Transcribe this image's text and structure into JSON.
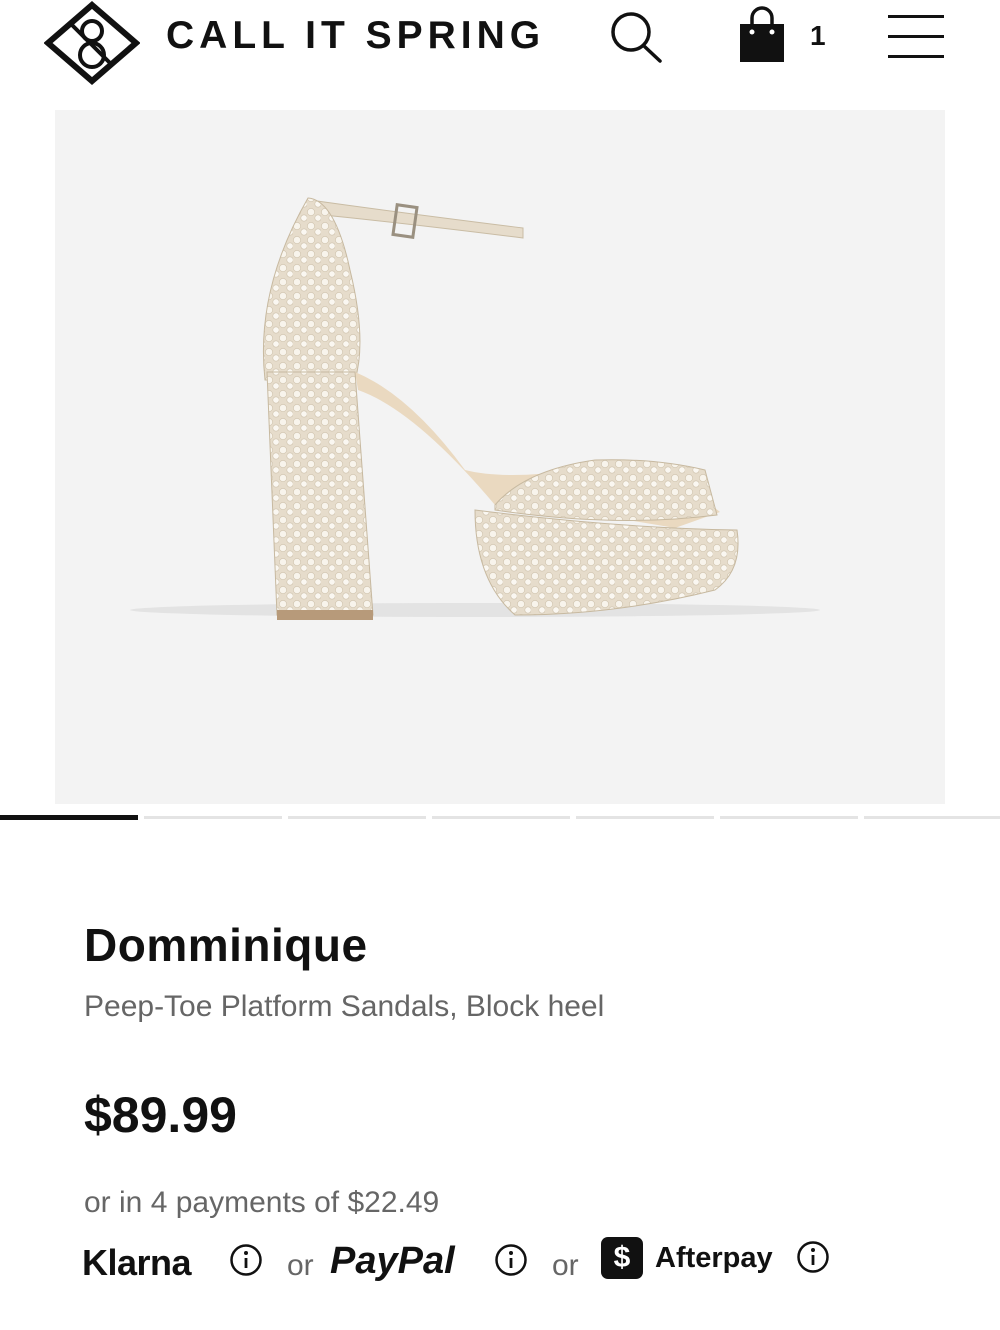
{
  "header": {
    "brand": "CALL IT SPRING",
    "bag_count": "1"
  },
  "icons": {
    "logo": "brand-logo-diamond",
    "search": "search-icon",
    "bag": "shopping-bag-icon",
    "menu": "hamburger-menu-icon",
    "info": "info-icon"
  },
  "carousel": {
    "total": 7,
    "active_index": 0
  },
  "product": {
    "name": "Domminique",
    "description": "Peep-Toe Platform Sandals, Block heel",
    "price": "$89.99",
    "installments": "or in 4 payments of $22.49"
  },
  "payment": {
    "klarna": "Klarna",
    "or1": "or",
    "paypal": "PayPal",
    "or2": "or",
    "afterpay_badge": "$",
    "afterpay": "Afterpay"
  },
  "colors": {
    "text": "#111111",
    "muted": "#666666",
    "image_bg": "#f3f3f3",
    "indicator_inactive": "#e4e4e4"
  }
}
